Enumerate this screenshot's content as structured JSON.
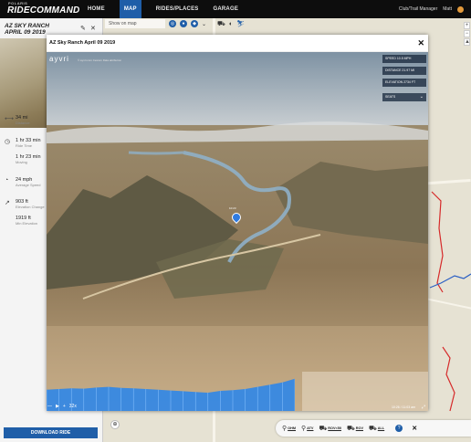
{
  "nav": {
    "brand_small": "POLARIS",
    "brand": "RIDECOMMAND",
    "links": [
      "HOME",
      "MAP",
      "RIDES/PLACES",
      "GARAGE"
    ],
    "active": "MAP",
    "club_manager": "Club/Trail Manager",
    "user": "Matt"
  },
  "map": {
    "search_placeholder": "Show on map"
  },
  "panel": {
    "title_line1": "AZ SKY RANCH",
    "title_line2": "APRIL 09 2019",
    "stats": [
      {
        "icon": "distance-icon",
        "value": "34 mi",
        "label": "Distance"
      },
      {
        "icon": "clock-icon",
        "value": "1 hr 33 min",
        "label": "Ride Time"
      },
      {
        "icon": "moving-icon",
        "value": "1 hr 23 min",
        "label": "Moving"
      },
      {
        "icon": "speed-icon",
        "value": "24 mph",
        "label": "Average Speed"
      },
      {
        "icon": "elevation-icon",
        "value": "903 ft",
        "label": "Elevation Change"
      },
      {
        "icon": "min-elevation-icon",
        "value": "1919 ft",
        "label": "Min Elevation"
      }
    ],
    "download_label": "DOWNLOAD RIDE"
  },
  "modal": {
    "title": "AZ Sky Ranch April 09 2019",
    "close": "✕",
    "logo": "ayvri",
    "logo_sub": "© ayvri.com  Cesium  Data attribution",
    "hud": {
      "speed": "SPEED   10.5 MPH",
      "distance": "DISTANCE   21.97 MI",
      "elevation": "ELEVATION   2734 FT",
      "select": "SEATS"
    },
    "marker_label": "10:23",
    "playback_speed": "32x",
    "time_readout": "10:26 / 11:03 am"
  },
  "filters": {
    "items": [
      {
        "icon": "ohm-icon",
        "label": "OHM"
      },
      {
        "icon": "atv-icon",
        "label": "ATV"
      },
      {
        "icon": "rov50-icon",
        "label": "ROV<50"
      },
      {
        "icon": "rov-icon",
        "label": "ROV"
      },
      {
        "icon": "all-icon",
        "label": "ALL"
      }
    ]
  },
  "colors": {
    "accent": "#1f5ea8",
    "trail_red": "#d62a2a",
    "trail_blue": "#2a5fc4",
    "elevation_fill": "#2f86e8"
  },
  "chart_data": {
    "type": "area",
    "title": "",
    "xlabel": "",
    "ylabel": "",
    "note_series": "elevation profile of ride (relative)",
    "x": [
      0,
      1,
      2,
      3,
      4,
      5,
      6,
      7,
      8,
      9,
      10,
      11,
      12,
      13,
      14,
      15,
      16,
      17,
      18,
      19,
      20
    ],
    "values": [
      0.58,
      0.6,
      0.62,
      0.61,
      0.64,
      0.66,
      0.63,
      0.62,
      0.6,
      0.58,
      0.56,
      0.54,
      0.52,
      0.5,
      0.55,
      0.57,
      0.6,
      0.66,
      0.72,
      0.78,
      0.88
    ],
    "ylim": [
      0,
      1
    ]
  }
}
